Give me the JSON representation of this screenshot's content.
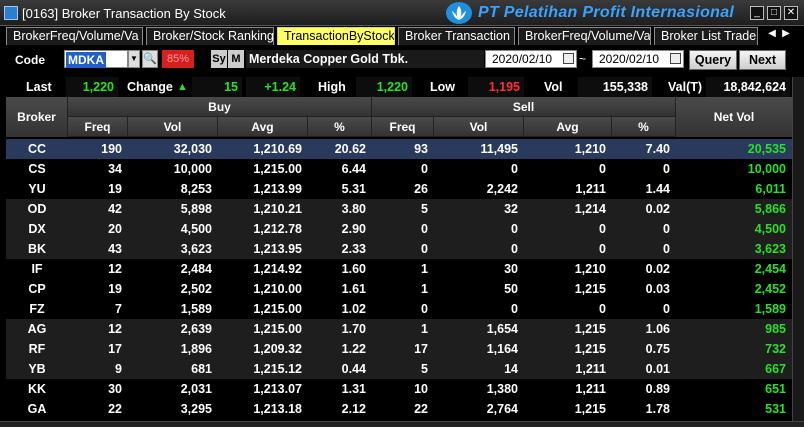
{
  "window": {
    "title": "[0163] Broker Transaction By Stock",
    "watermark": "PT Pelatihan Profit Internasional"
  },
  "tabs": [
    {
      "label": "BrokerFreq/Volume/Va"
    },
    {
      "label": "Broker/Stock Ranking"
    },
    {
      "label": "TransactionByStock"
    },
    {
      "label": "Broker Transaction"
    },
    {
      "label": "BrokerFreq/Volume/Va"
    },
    {
      "label": "Broker List Trade"
    }
  ],
  "query": {
    "code_label": "Code",
    "code_value": "MDKA",
    "pct_badge": "85%",
    "sy_label": "Sy",
    "m_label": "M",
    "stock_name": "Merdeka Copper Gold Tbk.",
    "date_from": "2020/02/10",
    "date_sep": "~",
    "date_to": "2020/02/10",
    "query_button": "Query",
    "next_button": "Next"
  },
  "summary": {
    "last_label": "Last",
    "last_value": "1,220",
    "change_label": "Change",
    "change_arrow": "▲",
    "change_value": "15",
    "change_pct": "+1.24",
    "high_label": "High",
    "high_value": "1,220",
    "low_label": "Low",
    "low_value": "1,195",
    "vol_label": "Vol",
    "vol_value": "155,338",
    "valt_label": "Val(T)",
    "valt_value": "18,842,624"
  },
  "table": {
    "broker_header": "Broker",
    "buy_header": "Buy",
    "sell_header": "Sell",
    "netvol_header": "Net Vol",
    "sub_headers": {
      "buy_freq": "Freq",
      "buy_vol": "Vol",
      "buy_avg": "Avg",
      "buy_pct": "%",
      "sell_freq": "Freq",
      "sell_vol": "Vol",
      "sell_avg": "Avg",
      "sell_pct": "%"
    },
    "rows": [
      [
        "CC",
        "190",
        "32,030",
        "1,210.69",
        "20.62",
        "93",
        "11,495",
        "1,210",
        "7.40",
        "20,535"
      ],
      [
        "CS",
        "34",
        "10,000",
        "1,215.00",
        "6.44",
        "0",
        "0",
        "0",
        "0",
        "10,000"
      ],
      [
        "YU",
        "19",
        "8,253",
        "1,213.99",
        "5.31",
        "26",
        "2,242",
        "1,211",
        "1.44",
        "6,011"
      ],
      [
        "OD",
        "42",
        "5,898",
        "1,210.21",
        "3.80",
        "5",
        "32",
        "1,214",
        "0.02",
        "5,866"
      ],
      [
        "DX",
        "20",
        "4,500",
        "1,212.78",
        "2.90",
        "0",
        "0",
        "0",
        "0",
        "4,500"
      ],
      [
        "BK",
        "43",
        "3,623",
        "1,213.95",
        "2.33",
        "0",
        "0",
        "0",
        "0",
        "3,623"
      ],
      [
        "IF",
        "12",
        "2,484",
        "1,214.92",
        "1.60",
        "1",
        "30",
        "1,210",
        "0.02",
        "2,454"
      ],
      [
        "CP",
        "19",
        "2,502",
        "1,210.00",
        "1.61",
        "1",
        "50",
        "1,215",
        "0.03",
        "2,452"
      ],
      [
        "FZ",
        "7",
        "1,589",
        "1,215.00",
        "1.02",
        "0",
        "0",
        "0",
        "0",
        "1,589"
      ],
      [
        "AG",
        "12",
        "2,639",
        "1,215.00",
        "1.70",
        "1",
        "1,654",
        "1,215",
        "1.06",
        "985"
      ],
      [
        "RF",
        "17",
        "1,896",
        "1,209.32",
        "1.22",
        "17",
        "1,164",
        "1,215",
        "0.75",
        "732"
      ],
      [
        "YB",
        "9",
        "681",
        "1,215.12",
        "0.44",
        "5",
        "14",
        "1,211",
        "0.01",
        "667"
      ],
      [
        "KK",
        "30",
        "2,031",
        "1,213.07",
        "1.31",
        "10",
        "1,380",
        "1,211",
        "0.89",
        "651"
      ],
      [
        "GA",
        "22",
        "3,295",
        "1,213.18",
        "2.12",
        "22",
        "2,764",
        "1,215",
        "1.78",
        "531"
      ]
    ]
  },
  "colors": {
    "up": "#28e028",
    "down": "#ff3030",
    "active_tab": "#ffff66",
    "selected_row": "#2a3a5c"
  }
}
